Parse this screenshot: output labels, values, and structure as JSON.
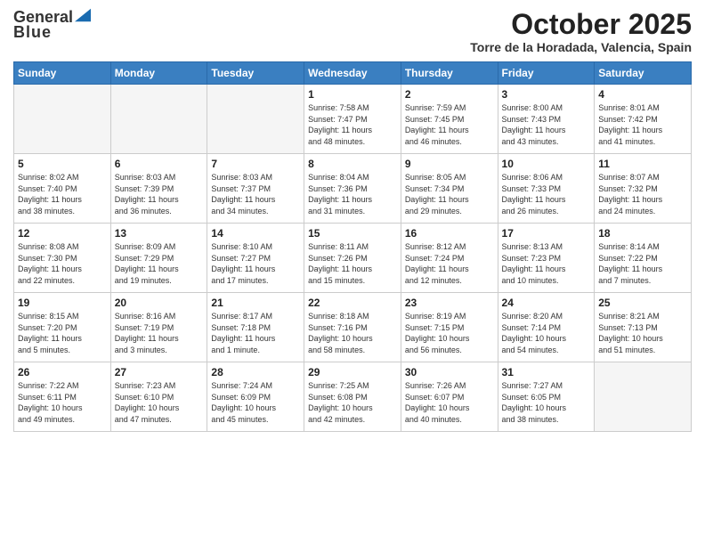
{
  "logo": {
    "general": "General",
    "blue": "Blue"
  },
  "title": "October 2025",
  "location": "Torre de la Horadada, Valencia, Spain",
  "weekdays": [
    "Sunday",
    "Monday",
    "Tuesday",
    "Wednesday",
    "Thursday",
    "Friday",
    "Saturday"
  ],
  "weeks": [
    [
      {
        "day": "",
        "info": ""
      },
      {
        "day": "",
        "info": ""
      },
      {
        "day": "",
        "info": ""
      },
      {
        "day": "1",
        "info": "Sunrise: 7:58 AM\nSunset: 7:47 PM\nDaylight: 11 hours\nand 48 minutes."
      },
      {
        "day": "2",
        "info": "Sunrise: 7:59 AM\nSunset: 7:45 PM\nDaylight: 11 hours\nand 46 minutes."
      },
      {
        "day": "3",
        "info": "Sunrise: 8:00 AM\nSunset: 7:43 PM\nDaylight: 11 hours\nand 43 minutes."
      },
      {
        "day": "4",
        "info": "Sunrise: 8:01 AM\nSunset: 7:42 PM\nDaylight: 11 hours\nand 41 minutes."
      }
    ],
    [
      {
        "day": "5",
        "info": "Sunrise: 8:02 AM\nSunset: 7:40 PM\nDaylight: 11 hours\nand 38 minutes."
      },
      {
        "day": "6",
        "info": "Sunrise: 8:03 AM\nSunset: 7:39 PM\nDaylight: 11 hours\nand 36 minutes."
      },
      {
        "day": "7",
        "info": "Sunrise: 8:03 AM\nSunset: 7:37 PM\nDaylight: 11 hours\nand 34 minutes."
      },
      {
        "day": "8",
        "info": "Sunrise: 8:04 AM\nSunset: 7:36 PM\nDaylight: 11 hours\nand 31 minutes."
      },
      {
        "day": "9",
        "info": "Sunrise: 8:05 AM\nSunset: 7:34 PM\nDaylight: 11 hours\nand 29 minutes."
      },
      {
        "day": "10",
        "info": "Sunrise: 8:06 AM\nSunset: 7:33 PM\nDaylight: 11 hours\nand 26 minutes."
      },
      {
        "day": "11",
        "info": "Sunrise: 8:07 AM\nSunset: 7:32 PM\nDaylight: 11 hours\nand 24 minutes."
      }
    ],
    [
      {
        "day": "12",
        "info": "Sunrise: 8:08 AM\nSunset: 7:30 PM\nDaylight: 11 hours\nand 22 minutes."
      },
      {
        "day": "13",
        "info": "Sunrise: 8:09 AM\nSunset: 7:29 PM\nDaylight: 11 hours\nand 19 minutes."
      },
      {
        "day": "14",
        "info": "Sunrise: 8:10 AM\nSunset: 7:27 PM\nDaylight: 11 hours\nand 17 minutes."
      },
      {
        "day": "15",
        "info": "Sunrise: 8:11 AM\nSunset: 7:26 PM\nDaylight: 11 hours\nand 15 minutes."
      },
      {
        "day": "16",
        "info": "Sunrise: 8:12 AM\nSunset: 7:24 PM\nDaylight: 11 hours\nand 12 minutes."
      },
      {
        "day": "17",
        "info": "Sunrise: 8:13 AM\nSunset: 7:23 PM\nDaylight: 11 hours\nand 10 minutes."
      },
      {
        "day": "18",
        "info": "Sunrise: 8:14 AM\nSunset: 7:22 PM\nDaylight: 11 hours\nand 7 minutes."
      }
    ],
    [
      {
        "day": "19",
        "info": "Sunrise: 8:15 AM\nSunset: 7:20 PM\nDaylight: 11 hours\nand 5 minutes."
      },
      {
        "day": "20",
        "info": "Sunrise: 8:16 AM\nSunset: 7:19 PM\nDaylight: 11 hours\nand 3 minutes."
      },
      {
        "day": "21",
        "info": "Sunrise: 8:17 AM\nSunset: 7:18 PM\nDaylight: 11 hours\nand 1 minute."
      },
      {
        "day": "22",
        "info": "Sunrise: 8:18 AM\nSunset: 7:16 PM\nDaylight: 10 hours\nand 58 minutes."
      },
      {
        "day": "23",
        "info": "Sunrise: 8:19 AM\nSunset: 7:15 PM\nDaylight: 10 hours\nand 56 minutes."
      },
      {
        "day": "24",
        "info": "Sunrise: 8:20 AM\nSunset: 7:14 PM\nDaylight: 10 hours\nand 54 minutes."
      },
      {
        "day": "25",
        "info": "Sunrise: 8:21 AM\nSunset: 7:13 PM\nDaylight: 10 hours\nand 51 minutes."
      }
    ],
    [
      {
        "day": "26",
        "info": "Sunrise: 7:22 AM\nSunset: 6:11 PM\nDaylight: 10 hours\nand 49 minutes."
      },
      {
        "day": "27",
        "info": "Sunrise: 7:23 AM\nSunset: 6:10 PM\nDaylight: 10 hours\nand 47 minutes."
      },
      {
        "day": "28",
        "info": "Sunrise: 7:24 AM\nSunset: 6:09 PM\nDaylight: 10 hours\nand 45 minutes."
      },
      {
        "day": "29",
        "info": "Sunrise: 7:25 AM\nSunset: 6:08 PM\nDaylight: 10 hours\nand 42 minutes."
      },
      {
        "day": "30",
        "info": "Sunrise: 7:26 AM\nSunset: 6:07 PM\nDaylight: 10 hours\nand 40 minutes."
      },
      {
        "day": "31",
        "info": "Sunrise: 7:27 AM\nSunset: 6:05 PM\nDaylight: 10 hours\nand 38 minutes."
      },
      {
        "day": "",
        "info": ""
      }
    ]
  ]
}
